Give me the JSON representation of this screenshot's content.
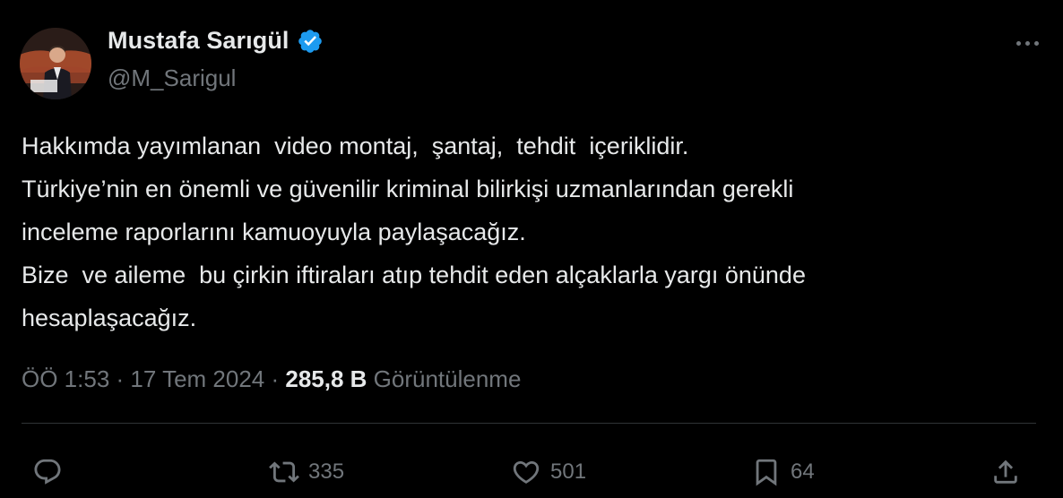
{
  "author": {
    "display_name": "Mustafa Sarıgül",
    "handle": "@M_Sarigul",
    "verified": true,
    "verified_color": "#1d9bf0"
  },
  "tweet": {
    "lines": [
      "Hakkımda yayımlanan  video montaj,  şantaj,  tehdit  içeriklidir.",
      "Türkiye’nin en önemli ve güvenilir kriminal bilirkişi uzmanlarından gerekli",
      "inceleme raporlarını kamuoyuyla paylaşacağız.",
      "Bize  ve aileme  bu çirkin iftiraları atıp tehdit eden alçaklarla yargı önünde",
      "hesaplaşacağız."
    ]
  },
  "meta": {
    "time": "ÖÖ 1:53",
    "separator": " · ",
    "date": "17 Tem 2024",
    "views_count": "285,8 B",
    "views_label": " Görüntülenme"
  },
  "actions": {
    "reply_icon": "reply-icon",
    "retweet_icon": "retweet-icon",
    "retweet_count": "335",
    "like_icon": "heart-icon",
    "like_count": "501",
    "bookmark_icon": "bookmark-icon",
    "bookmark_count": "64",
    "share_icon": "share-icon"
  },
  "colors": {
    "background": "#000000",
    "primary_text": "#e7e9ea",
    "secondary_text": "#71767b",
    "divider": "#2f3336"
  }
}
